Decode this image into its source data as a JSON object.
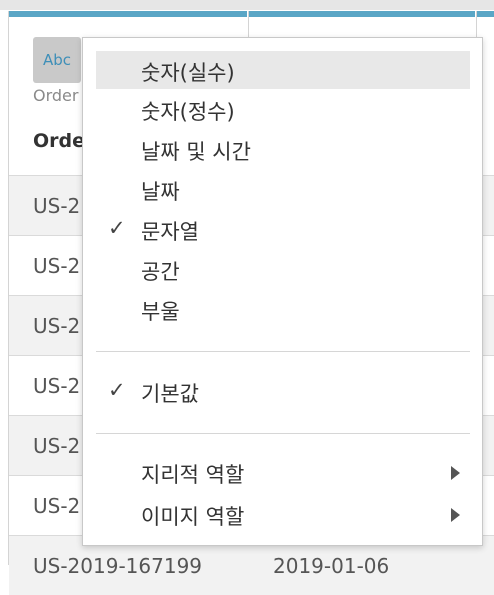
{
  "table": {
    "badge_label": "Abc",
    "header_origin": "Order",
    "header_name": "Orde",
    "rows": [
      {
        "c1": "US-2",
        "c2": ""
      },
      {
        "c1": "US-2",
        "c2": ""
      },
      {
        "c1": "US-2",
        "c2": ""
      },
      {
        "c1": "US-2",
        "c2": ""
      },
      {
        "c1": "US-2",
        "c2": ""
      },
      {
        "c1": "US-2",
        "c2": ""
      },
      {
        "c1": "US-2019-167199",
        "c2": "2019-01-06"
      }
    ]
  },
  "menu": {
    "items": [
      {
        "label": "숫자(실수)",
        "checked": false
      },
      {
        "label": "숫자(정수)",
        "checked": false
      },
      {
        "label": "날짜 및 시간",
        "checked": false
      },
      {
        "label": "날짜",
        "checked": false
      },
      {
        "label": "문자열",
        "checked": true
      },
      {
        "label": "공간",
        "checked": false
      },
      {
        "label": "부울",
        "checked": false
      }
    ],
    "default_item": {
      "label": "기본값",
      "checked": true
    },
    "submenus": [
      {
        "label": "지리적 역할"
      },
      {
        "label": "이미지 역할"
      }
    ],
    "check_glyph": "✓"
  }
}
